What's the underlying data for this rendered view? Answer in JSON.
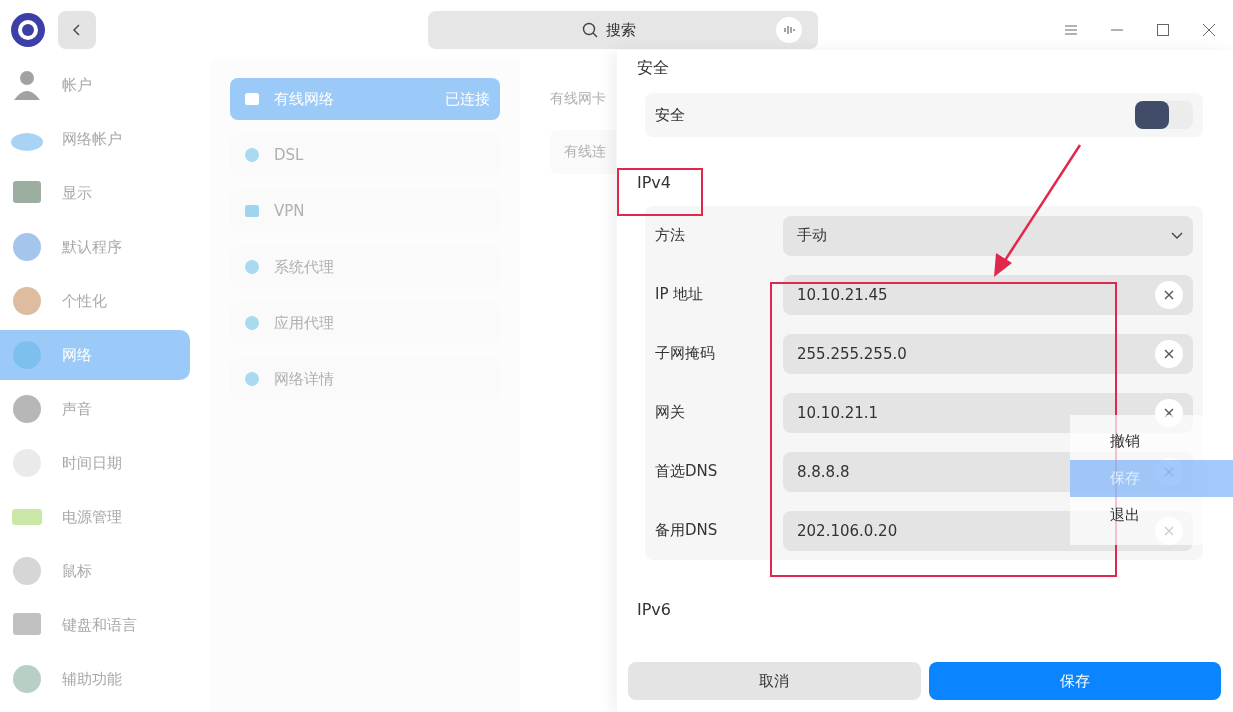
{
  "titlebar": {
    "search": {
      "placeholder": "搜索"
    }
  },
  "sidebar": {
    "items": [
      {
        "label": "帐户",
        "selected": false
      },
      {
        "label": "网络帐户",
        "selected": false
      },
      {
        "label": "显示",
        "selected": false
      },
      {
        "label": "默认程序",
        "selected": false
      },
      {
        "label": "个性化",
        "selected": false
      },
      {
        "label": "网络",
        "selected": true
      },
      {
        "label": "声音",
        "selected": false
      },
      {
        "label": "时间日期",
        "selected": false
      },
      {
        "label": "电源管理",
        "selected": false
      },
      {
        "label": "鼠标",
        "selected": false
      },
      {
        "label": "键盘和语言",
        "selected": false
      },
      {
        "label": "辅助功能",
        "selected": false
      }
    ]
  },
  "network_menu": {
    "items": [
      {
        "label": "有线网络",
        "status": "已连接",
        "selected": true
      },
      {
        "label": "DSL",
        "selected": false
      },
      {
        "label": "VPN",
        "selected": false
      },
      {
        "label": "系统代理",
        "selected": false
      },
      {
        "label": "应用代理",
        "selected": false
      },
      {
        "label": "网络详情",
        "selected": false
      }
    ]
  },
  "devices": {
    "heading": "有线网卡",
    "items": [
      {
        "label": "有线连"
      }
    ]
  },
  "settings_panel": {
    "security": {
      "heading": "安全",
      "label": "安全",
      "on": false
    },
    "ipv4": {
      "heading": "IPv4",
      "method": {
        "label": "方法",
        "value": "手动"
      },
      "fields": [
        {
          "label": "IP 地址",
          "value": "10.10.21.45"
        },
        {
          "label": "子网掩码",
          "value": "255.255.255.0"
        },
        {
          "label": "网关",
          "value": "10.10.21.1"
        },
        {
          "label": "首选DNS",
          "value": "8.8.8.8"
        },
        {
          "label": "备用DNS",
          "value": "202.106.0.20"
        }
      ]
    },
    "ipv6": {
      "heading": "IPv6"
    },
    "buttons": [
      {
        "label": "取消",
        "kind": "secondary"
      },
      {
        "label": "保存",
        "kind": "primary"
      }
    ]
  },
  "context_menu": {
    "items": [
      {
        "label": "撤销",
        "selected": false
      },
      {
        "label": "保存",
        "selected": true
      },
      {
        "label": "退出",
        "selected": false
      }
    ]
  }
}
